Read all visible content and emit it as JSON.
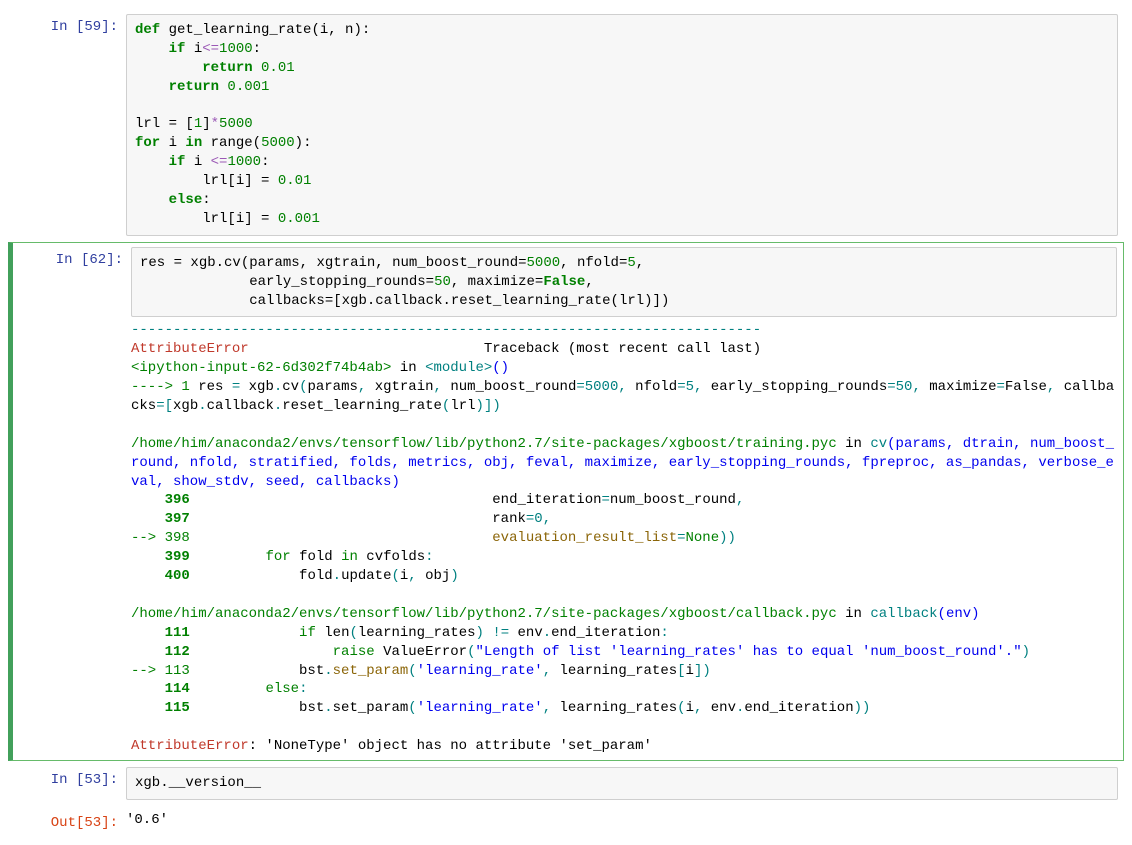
{
  "cells": {
    "c59": {
      "prompt": "In [59]:",
      "code_tokens": [
        {
          "t": "def ",
          "c": "kw"
        },
        {
          "t": "get_learning_rate"
        },
        {
          "t": "("
        },
        {
          "t": "i"
        },
        {
          "t": ","
        },
        {
          "t": " n"
        },
        {
          "t": ")"
        },
        {
          "t": ":"
        },
        {
          "t": "\n"
        },
        {
          "t": "    "
        },
        {
          "t": "if ",
          "c": "kw"
        },
        {
          "t": "i"
        },
        {
          "t": "<=",
          "c": "op"
        },
        {
          "t": "1000",
          "c": "num"
        },
        {
          "t": ":"
        },
        {
          "t": "\n"
        },
        {
          "t": "        "
        },
        {
          "t": "return ",
          "c": "kw"
        },
        {
          "t": "0.01",
          "c": "num"
        },
        {
          "t": "\n"
        },
        {
          "t": "    "
        },
        {
          "t": "return ",
          "c": "kw"
        },
        {
          "t": "0.001",
          "c": "num"
        },
        {
          "t": "\n"
        },
        {
          "t": "\n"
        },
        {
          "t": "lrl "
        },
        {
          "t": "="
        },
        {
          "t": " ["
        },
        {
          "t": "1",
          "c": "num"
        },
        {
          "t": "]"
        },
        {
          "t": "*",
          "c": "op"
        },
        {
          "t": "5000",
          "c": "num"
        },
        {
          "t": "\n"
        },
        {
          "t": "for ",
          "c": "kw"
        },
        {
          "t": "i "
        },
        {
          "t": "in ",
          "c": "kw"
        },
        {
          "t": "range"
        },
        {
          "t": "("
        },
        {
          "t": "5000",
          "c": "num"
        },
        {
          "t": ")"
        },
        {
          "t": ":"
        },
        {
          "t": "\n"
        },
        {
          "t": "    "
        },
        {
          "t": "if ",
          "c": "kw"
        },
        {
          "t": "i "
        },
        {
          "t": "<=",
          "c": "op"
        },
        {
          "t": "1000",
          "c": "num"
        },
        {
          "t": ":"
        },
        {
          "t": "\n"
        },
        {
          "t": "        lrl[i] "
        },
        {
          "t": "="
        },
        {
          "t": " "
        },
        {
          "t": "0.01",
          "c": "num"
        },
        {
          "t": "\n"
        },
        {
          "t": "    "
        },
        {
          "t": "else",
          "c": "kw"
        },
        {
          "t": ":"
        },
        {
          "t": "\n"
        },
        {
          "t": "        lrl[i] "
        },
        {
          "t": "="
        },
        {
          "t": " "
        },
        {
          "t": "0.001",
          "c": "num"
        }
      ]
    },
    "c62": {
      "prompt": "In [62]:",
      "code_tokens": [
        {
          "t": "res "
        },
        {
          "t": "="
        },
        {
          "t": " xgb"
        },
        {
          "t": "."
        },
        {
          "t": "cv"
        },
        {
          "t": "("
        },
        {
          "t": "params"
        },
        {
          "t": ","
        },
        {
          "t": " xgtrain"
        },
        {
          "t": ","
        },
        {
          "t": " num_boost_round"
        },
        {
          "t": "="
        },
        {
          "t": "5000",
          "c": "num"
        },
        {
          "t": ","
        },
        {
          "t": " nfold"
        },
        {
          "t": "="
        },
        {
          "t": "5",
          "c": "num"
        },
        {
          "t": ","
        },
        {
          "t": "\n"
        },
        {
          "t": "             early_stopping_rounds"
        },
        {
          "t": "="
        },
        {
          "t": "50",
          "c": "num"
        },
        {
          "t": ","
        },
        {
          "t": " maximize"
        },
        {
          "t": "="
        },
        {
          "t": "False",
          "c": "kw"
        },
        {
          "t": ","
        },
        {
          "t": "\n"
        },
        {
          "t": "             callbacks"
        },
        {
          "t": "="
        },
        {
          "t": "[xgb"
        },
        {
          "t": "."
        },
        {
          "t": "callback"
        },
        {
          "t": "."
        },
        {
          "t": "reset_learning_rate"
        },
        {
          "t": "("
        },
        {
          "t": "lrl"
        },
        {
          "t": ")])"
        }
      ],
      "tb_tokens": [
        {
          "t": "---------------------------------------------------------------------------\n",
          "c": "tb-teal"
        },
        {
          "t": "AttributeError",
          "c": "tb-red"
        },
        {
          "t": "                            Traceback (most recent call last)\n"
        },
        {
          "t": "<ipython-input-62-6d302f74b4ab>",
          "c": "tb-green"
        },
        {
          "t": " in "
        },
        {
          "t": "<module>",
          "c": "tb-teal"
        },
        {
          "t": "()",
          "c": "tb-blue"
        },
        {
          "t": "\n"
        },
        {
          "t": "----> 1",
          "c": "tb-green"
        },
        {
          "t": " res "
        },
        {
          "t": "=",
          "c": "tb-teal"
        },
        {
          "t": " xgb"
        },
        {
          "t": ".",
          "c": "tb-teal"
        },
        {
          "t": "cv"
        },
        {
          "t": "(",
          "c": "tb-teal"
        },
        {
          "t": "params"
        },
        {
          "t": ",",
          "c": "tb-teal"
        },
        {
          "t": " xgtrain"
        },
        {
          "t": ",",
          "c": "tb-teal"
        },
        {
          "t": " num_boost_round"
        },
        {
          "t": "=",
          "c": "tb-teal"
        },
        {
          "t": "5000",
          "c": "tb-teal"
        },
        {
          "t": ",",
          "c": "tb-teal"
        },
        {
          "t": " nfold"
        },
        {
          "t": "=",
          "c": "tb-teal"
        },
        {
          "t": "5",
          "c": "tb-teal"
        },
        {
          "t": ",",
          "c": "tb-teal"
        },
        {
          "t": " early_stopping_rounds"
        },
        {
          "t": "=",
          "c": "tb-teal"
        },
        {
          "t": "50",
          "c": "tb-teal"
        },
        {
          "t": ",",
          "c": "tb-teal"
        },
        {
          "t": " maximize"
        },
        {
          "t": "=",
          "c": "tb-teal"
        },
        {
          "t": "False"
        },
        {
          "t": ",",
          "c": "tb-teal"
        },
        {
          "t": " callbacks"
        },
        {
          "t": "=",
          "c": "tb-teal"
        },
        {
          "t": "[",
          "c": "tb-teal"
        },
        {
          "t": "xgb"
        },
        {
          "t": ".",
          "c": "tb-teal"
        },
        {
          "t": "callback"
        },
        {
          "t": ".",
          "c": "tb-teal"
        },
        {
          "t": "reset_learning_rate"
        },
        {
          "t": "(",
          "c": "tb-teal"
        },
        {
          "t": "lrl"
        },
        {
          "t": ")])",
          "c": "tb-teal"
        },
        {
          "t": "\n"
        },
        {
          "t": "\n"
        },
        {
          "t": "/home/him/anaconda2/envs/tensorflow/lib/python2.7/site-packages/xgboost/training.pyc",
          "c": "tb-green"
        },
        {
          "t": " in "
        },
        {
          "t": "cv",
          "c": "tb-teal"
        },
        {
          "t": "(params, dtrain, num_boost_round, nfold, stratified, folds, metrics, obj, feval, maximize, early_stopping_rounds, fpreproc, as_pandas, verbose_eval, show_stdv, seed, callbacks)",
          "c": "tb-blue"
        },
        {
          "t": "\n"
        },
        {
          "t": "    396",
          "c": "tb-green tb-bold"
        },
        {
          "t": "                                    end_iteration"
        },
        {
          "t": "=",
          "c": "tb-teal"
        },
        {
          "t": "num_boost_round"
        },
        {
          "t": ",",
          "c": "tb-teal"
        },
        {
          "t": "\n"
        },
        {
          "t": "    397",
          "c": "tb-green tb-bold"
        },
        {
          "t": "                                    rank"
        },
        {
          "t": "=",
          "c": "tb-teal"
        },
        {
          "t": "0",
          "c": "tb-teal"
        },
        {
          "t": ",",
          "c": "tb-teal"
        },
        {
          "t": "\n"
        },
        {
          "t": "--> 398",
          "c": "tb-green"
        },
        {
          "t": "                                    evaluation_result_list",
          "c": "tb-yel"
        },
        {
          "t": "=",
          "c": "tb-teal"
        },
        {
          "t": "None",
          "c": "tb-green"
        },
        {
          "t": "))",
          "c": "tb-teal"
        },
        {
          "t": "\n"
        },
        {
          "t": "    399",
          "c": "tb-green tb-bold"
        },
        {
          "t": "         "
        },
        {
          "t": "for",
          "c": "tb-green"
        },
        {
          "t": " fold "
        },
        {
          "t": "in",
          "c": "tb-green"
        },
        {
          "t": " cvfolds"
        },
        {
          "t": ":",
          "c": "tb-teal"
        },
        {
          "t": "\n"
        },
        {
          "t": "    400",
          "c": "tb-green tb-bold"
        },
        {
          "t": "             fold"
        },
        {
          "t": ".",
          "c": "tb-teal"
        },
        {
          "t": "update"
        },
        {
          "t": "(",
          "c": "tb-teal"
        },
        {
          "t": "i"
        },
        {
          "t": ",",
          "c": "tb-teal"
        },
        {
          "t": " obj"
        },
        {
          "t": ")",
          "c": "tb-teal"
        },
        {
          "t": "\n"
        },
        {
          "t": "\n"
        },
        {
          "t": "/home/him/anaconda2/envs/tensorflow/lib/python2.7/site-packages/xgboost/callback.pyc",
          "c": "tb-green"
        },
        {
          "t": " in "
        },
        {
          "t": "callback",
          "c": "tb-teal"
        },
        {
          "t": "(env)",
          "c": "tb-blue"
        },
        {
          "t": "\n"
        },
        {
          "t": "    111",
          "c": "tb-green tb-bold"
        },
        {
          "t": "             "
        },
        {
          "t": "if",
          "c": "tb-green"
        },
        {
          "t": " len"
        },
        {
          "t": "(",
          "c": "tb-teal"
        },
        {
          "t": "learning_rates"
        },
        {
          "t": ")",
          "c": "tb-teal"
        },
        {
          "t": " "
        },
        {
          "t": "!=",
          "c": "tb-teal"
        },
        {
          "t": " env"
        },
        {
          "t": ".",
          "c": "tb-teal"
        },
        {
          "t": "end_iteration"
        },
        {
          "t": ":",
          "c": "tb-teal"
        },
        {
          "t": "\n"
        },
        {
          "t": "    112",
          "c": "tb-green tb-bold"
        },
        {
          "t": "                 "
        },
        {
          "t": "raise",
          "c": "tb-green"
        },
        {
          "t": " ValueError"
        },
        {
          "t": "(",
          "c": "tb-teal"
        },
        {
          "t": "\"Length of list 'learning_rates' has to equal 'num_boost_round'.\"",
          "c": "tb-blue"
        },
        {
          "t": ")",
          "c": "tb-teal"
        },
        {
          "t": "\n"
        },
        {
          "t": "--> 113",
          "c": "tb-green"
        },
        {
          "t": "             bst"
        },
        {
          "t": ".",
          "c": "tb-teal"
        },
        {
          "t": "set_param",
          "c": "tb-yel"
        },
        {
          "t": "(",
          "c": "tb-teal"
        },
        {
          "t": "'learning_rate'",
          "c": "tb-blue"
        },
        {
          "t": ",",
          "c": "tb-teal"
        },
        {
          "t": " learning_rates"
        },
        {
          "t": "[",
          "c": "tb-teal"
        },
        {
          "t": "i"
        },
        {
          "t": "])",
          "c": "tb-teal"
        },
        {
          "t": "\n"
        },
        {
          "t": "    114",
          "c": "tb-green tb-bold"
        },
        {
          "t": "         "
        },
        {
          "t": "else",
          "c": "tb-green"
        },
        {
          "t": ":",
          "c": "tb-teal"
        },
        {
          "t": "\n"
        },
        {
          "t": "    115",
          "c": "tb-green tb-bold"
        },
        {
          "t": "             bst"
        },
        {
          "t": ".",
          "c": "tb-teal"
        },
        {
          "t": "set_param"
        },
        {
          "t": "(",
          "c": "tb-teal"
        },
        {
          "t": "'learning_rate'",
          "c": "tb-blue"
        },
        {
          "t": ",",
          "c": "tb-teal"
        },
        {
          "t": " learning_rates"
        },
        {
          "t": "(",
          "c": "tb-teal"
        },
        {
          "t": "i"
        },
        {
          "t": ",",
          "c": "tb-teal"
        },
        {
          "t": " env"
        },
        {
          "t": ".",
          "c": "tb-teal"
        },
        {
          "t": "end_iteration"
        },
        {
          "t": "))",
          "c": "tb-teal"
        },
        {
          "t": "\n"
        },
        {
          "t": "\n"
        },
        {
          "t": "AttributeError",
          "c": "tb-red"
        },
        {
          "t": ": 'NoneType' object has no attribute 'set_param'"
        }
      ]
    },
    "c53in": {
      "prompt": "In [53]:",
      "code_tokens": [
        {
          "t": "xgb"
        },
        {
          "t": "."
        },
        {
          "t": "__version__"
        }
      ]
    },
    "c53out": {
      "prompt": "Out[53]:",
      "text": "'0.6'"
    }
  }
}
